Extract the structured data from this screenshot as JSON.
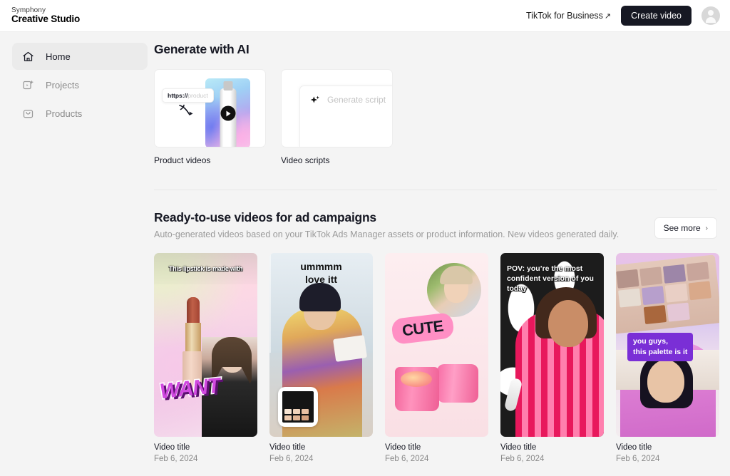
{
  "header": {
    "brand_top": "Symphony",
    "brand_bottom": "Creative Studio",
    "business_link": "TikTok for Business",
    "business_link_arrow": "↗",
    "create_video_label": "Create video",
    "avatar_icon": "user-avatar-icon"
  },
  "sidebar": {
    "items": [
      {
        "label": "Home",
        "icon": "home-icon",
        "active": true
      },
      {
        "label": "Projects",
        "icon": "video-project-icon",
        "active": false
      },
      {
        "label": "Products",
        "icon": "shopping-bag-icon",
        "active": false
      }
    ]
  },
  "generate": {
    "title": "Generate with AI",
    "cards": [
      {
        "caption": "Product videos",
        "url_prefix": "https://",
        "url_placeholder": "product",
        "icon": "curved-arrow-icon",
        "play_icon": "play-icon"
      },
      {
        "caption": "Video scripts",
        "placeholder": "Generate script",
        "icon": "sparkle-icon"
      }
    ]
  },
  "ready": {
    "title": "Ready-to-use videos for ad campaigns",
    "subtitle": "Auto-generated videos based on your TikTok Ads Manager assets or product information. New videos generated daily.",
    "see_more_label": "See more",
    "see_more_chevron": "›",
    "videos": [
      {
        "overlay_text": "This lipstick is made with",
        "sticker": "WANT",
        "title": "Video title",
        "date": "Feb 6, 2024"
      },
      {
        "overlay_text": "ummmm\nlove itt",
        "sticker": "",
        "title": "Video title",
        "date": "Feb 6, 2024"
      },
      {
        "overlay_text": "",
        "sticker": "CUTE",
        "title": "Video title",
        "date": "Feb 6, 2024"
      },
      {
        "overlay_text": "POV: you’re the most confident version of you today",
        "sticker": "",
        "title": "Video title",
        "date": "Feb 6, 2024"
      },
      {
        "overlay_text": "you guys,\nthis palette is it",
        "sticker": "",
        "title": "Video title",
        "date": "Feb 6, 2024"
      }
    ]
  },
  "colors": {
    "page_bg": "#f4f4f4",
    "header_bg": "#ffffff",
    "accent_dark": "#161823",
    "muted_text": "#8a8a8a",
    "caption_purple": "#7a2fd6",
    "sticker_pink": "#ff8fc4"
  }
}
